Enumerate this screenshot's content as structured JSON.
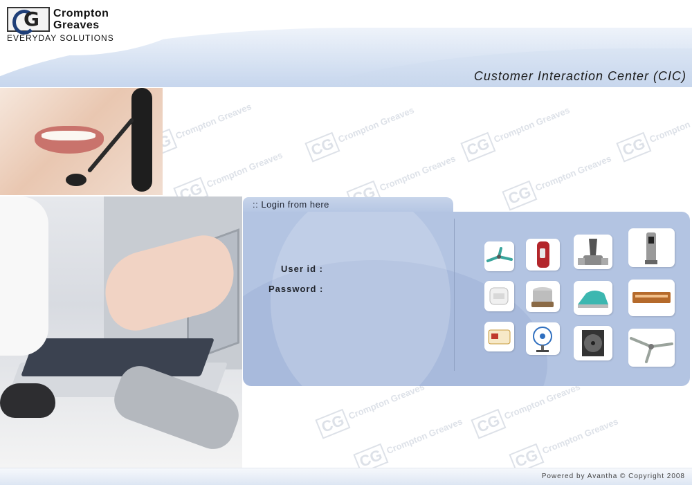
{
  "header": {
    "logo_line1": "Crompton",
    "logo_line2": "Greaves",
    "logo_tagline": "EVERYDAY SOLUTIONS",
    "app_title": "Customer Interaction Center (CIC)"
  },
  "login": {
    "tab_label": ":: Login from here",
    "userid_label": "User id :",
    "password_label": "Password :",
    "userid_value": "",
    "password_value": ""
  },
  "products": [
    {
      "name": "fan-ceiling-small-icon"
    },
    {
      "name": "water-heater-icon"
    },
    {
      "name": "mixer-grinder-icon"
    },
    {
      "name": "water-purifier-icon"
    },
    {
      "name": "sandwich-toaster-icon"
    },
    {
      "name": "wet-grinder-icon"
    },
    {
      "name": "steam-iron-icon"
    },
    {
      "name": "room-heater-icon"
    },
    {
      "name": "stabilizer-icon"
    },
    {
      "name": "table-fan-icon"
    },
    {
      "name": "exhaust-fan-icon"
    },
    {
      "name": "ceiling-fan-icon"
    }
  ],
  "watermark": {
    "text": "Crompton Greaves",
    "mark": "CG"
  },
  "footer": {
    "text": "Powered by Avantha © Copyright 2008"
  },
  "colors": {
    "panel": "#b3c4e2",
    "header_wave": "#9fb8df",
    "accent_dark": "#1f3f78"
  }
}
